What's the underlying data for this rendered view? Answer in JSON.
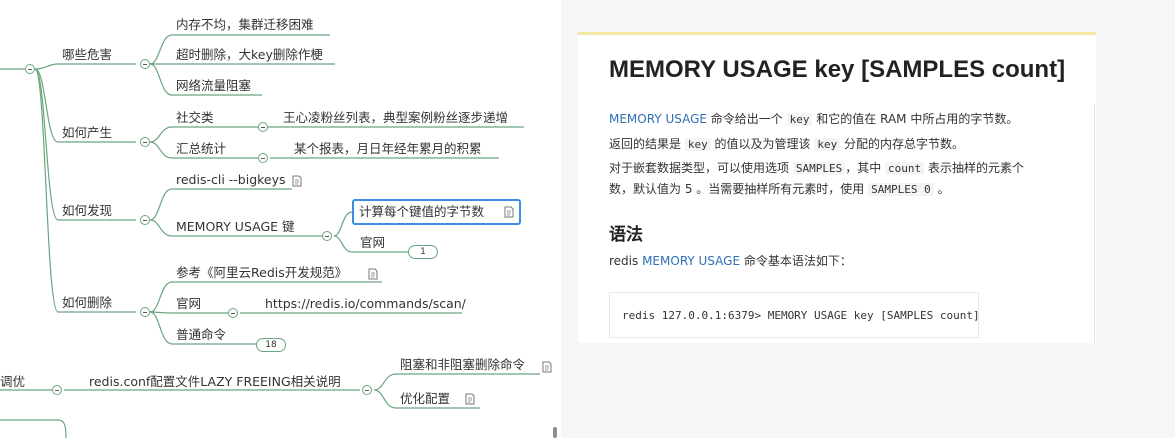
{
  "mindmap": {
    "nodes": {
      "harm": "哪些危害",
      "harm_memory": "内存不均，集群迁移困难",
      "harm_timeout": "超时删除，大key删除作梗",
      "harm_network": "网络流量阻塞",
      "cause": "如何产生",
      "cause_social": "社交类",
      "cause_social_detail": "王心凌粉丝列表，典型案例粉丝逐步递增",
      "cause_stats": "汇总统计",
      "cause_stats_detail": "某个报表，月日年经年累月的积累",
      "find": "如何发现",
      "find_cli": "redis-cli --bigkeys",
      "find_mem": "MEMORY USAGE 键",
      "find_mem_calc": "计算每个键值的字节数",
      "find_mem_site": "官网",
      "delete": "如何删除",
      "delete_ref": "参考《阿里云Redis开发规范》",
      "delete_site": "官网",
      "delete_site_url": "https://redis.io/commands/scan/",
      "delete_cmd": "普通命令",
      "tune": "调优",
      "tune_conf": "redis.conf配置文件LAZY FREEING相关说明",
      "tune_block": "阻塞和非阻塞删除命令",
      "tune_optimize": "优化配置"
    },
    "badges": {
      "find_mem_site_count": "1",
      "delete_cmd_count": "18"
    },
    "colors": {
      "branch": "#6aa57f",
      "selected": "#3a8ee6"
    }
  },
  "doc": {
    "title": "MEMORY USAGE key [SAMPLES count]",
    "p1": {
      "link": "MEMORY USAGE",
      "a": " 命令给出一个 ",
      "code1": "key",
      "b": " 和它的值在 RAM 中所占用的字节数。"
    },
    "p2": {
      "a": "返回的结果是 ",
      "code1": "key",
      "b": " 的值以及为管理该 ",
      "code2": "key",
      "c": " 分配的内存总字节数。"
    },
    "p3": {
      "a": "对于嵌套数据类型，可以使用选项 ",
      "code1": "SAMPLES",
      "b": "，其中 ",
      "code2": "count",
      "c": " 表示抽样的元素个"
    },
    "p4": {
      "a": "数，默认值为 5 。当需要抽样所有元素时，使用 ",
      "code1": "SAMPLES 0",
      "b": " 。"
    },
    "syntax_heading": "语法",
    "syntax_desc": {
      "a": "redis ",
      "link": "MEMORY USAGE",
      "b": " 命令基本语法如下："
    },
    "code": "redis 127.0.0.1:6379> MEMORY USAGE key [SAMPLES count]",
    "colors": {
      "link": "#2f6fb5",
      "top_bar": "#f2e6a3"
    }
  }
}
